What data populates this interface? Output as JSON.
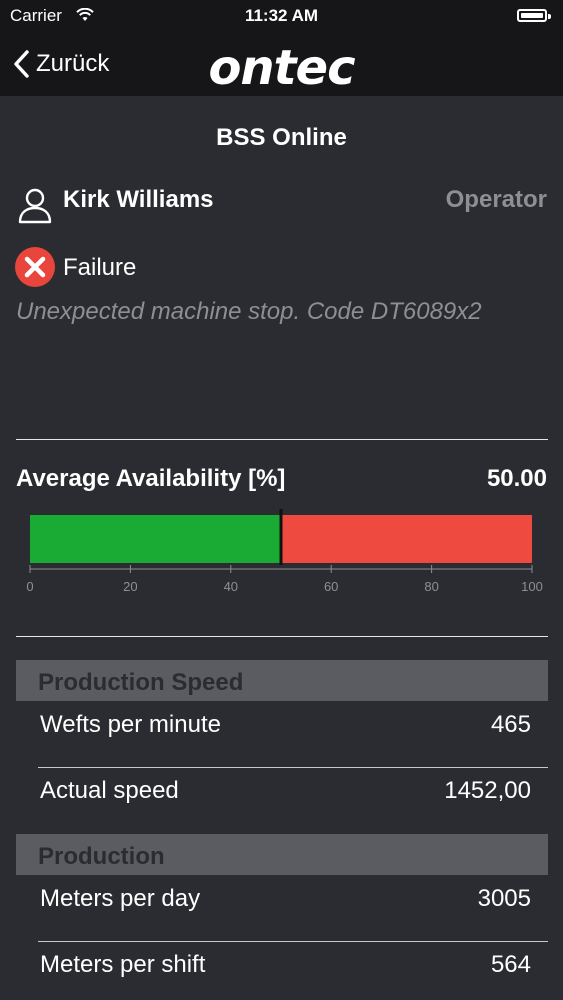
{
  "status_bar": {
    "carrier": "Carrier",
    "time": "11:32 AM"
  },
  "nav": {
    "back_label": "Zurück",
    "logo": "ontec"
  },
  "machine": {
    "title": "BSS Online"
  },
  "user": {
    "name": "Kirk Williams",
    "role": "Operator"
  },
  "status": {
    "label": "Failure",
    "message": "Unexpected machine stop. Code DT6089x2",
    "color": "#e8453c"
  },
  "availability": {
    "label": "Average Availability [%]",
    "value_text": "50.00"
  },
  "chart_data": {
    "type": "bar",
    "orientation": "horizontal-gauge",
    "value": 50.0,
    "xlim": [
      0,
      100
    ],
    "ticks": [
      "0",
      "20",
      "40",
      "60",
      "80",
      "100"
    ],
    "tick_values": [
      0,
      20,
      40,
      60,
      80,
      100
    ],
    "fill_color": "#1aab34",
    "remainder_color": "#ef4a3f"
  },
  "sections": [
    {
      "title": "Production Speed",
      "rows": [
        {
          "label": "Wefts per minute",
          "value": "465"
        },
        {
          "label": "Actual speed",
          "value": "1452,00"
        }
      ]
    },
    {
      "title": "Production",
      "rows": [
        {
          "label": "Meters per day",
          "value": "3005"
        },
        {
          "label": "Meters per shift",
          "value": "564"
        }
      ]
    }
  ]
}
